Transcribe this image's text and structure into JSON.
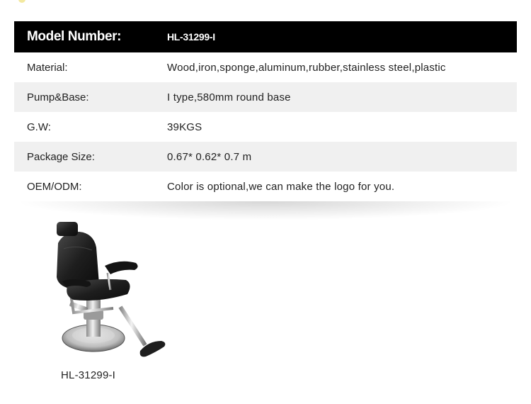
{
  "header": {
    "label": "Model Number:",
    "value": "HL-31299-I"
  },
  "rows": [
    {
      "label": "Material:",
      "value": "Wood,iron,sponge,aluminum,rubber,stainless steel,plastic"
    },
    {
      "label": "Pump&Base:",
      "value": "I type,580mm round base"
    },
    {
      "label": "G.W:",
      "value": "39KGS"
    },
    {
      "label": "Package Size:",
      "value": "0.67* 0.62* 0.7 m"
    },
    {
      "label": "OEM/ODM:",
      "value": "Color is optional,we can make the logo for you."
    }
  ],
  "product": {
    "caption": "HL-31299-I",
    "image": "barber-chair-image"
  }
}
